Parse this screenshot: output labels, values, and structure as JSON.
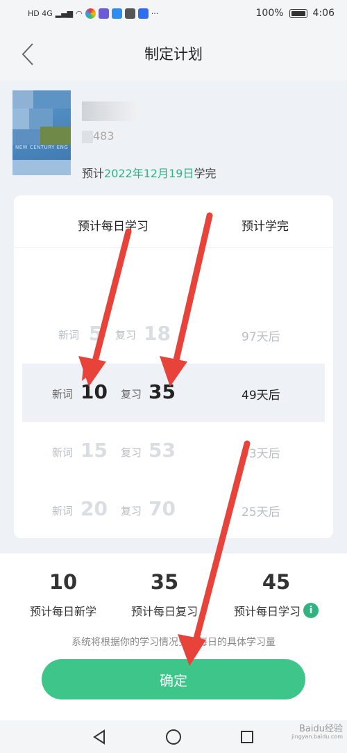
{
  "status_bar": {
    "network": "HD 4G",
    "battery": "100%",
    "time": "4:06"
  },
  "header": {
    "title": "制定计划"
  },
  "book": {
    "count_visible": "483",
    "finish_prefix": "预计",
    "finish_date": "2022年12月19日",
    "finish_suffix": "学完",
    "cover_text": "NEW CENTURY ENG"
  },
  "plan": {
    "col_left": "预计每日学习",
    "col_right": "预计学完",
    "new_label": "新词",
    "review_label": "复习",
    "rows": [
      {
        "new": "5",
        "review": "18",
        "days": "97天后",
        "selected": false
      },
      {
        "new": "10",
        "review": "35",
        "days": "49天后",
        "selected": true
      },
      {
        "new": "15",
        "review": "53",
        "days": "33天后",
        "selected": false
      },
      {
        "new": "20",
        "review": "70",
        "days": "25天后",
        "selected": false
      }
    ]
  },
  "summary": {
    "stats": [
      {
        "value": "10",
        "label": "预计每日新学"
      },
      {
        "value": "35",
        "label": "预计每日复习"
      },
      {
        "value": "45",
        "label": "预计每日学习"
      }
    ],
    "hint": "系统将根据你的学习情况安排每日的具体学习量",
    "confirm": "确定"
  },
  "watermark": {
    "main": "Baidu经验",
    "sub": "jingyan.baidu.com"
  },
  "colors": {
    "accent": "#3ec58a",
    "date_green": "#2fb47f",
    "arrow": "#e8433a"
  }
}
